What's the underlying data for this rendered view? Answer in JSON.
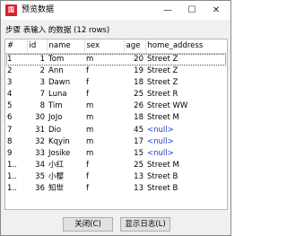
{
  "window": {
    "title": "预览数据",
    "icon_text": "国"
  },
  "subtitle": "步骤 表输入 的数据 (12 rows)",
  "table": {
    "headers": [
      "#",
      "id",
      "name",
      "sex",
      "age",
      "home_address"
    ],
    "rows": [
      {
        "rownum": "1",
        "id": "1",
        "name": "Tom",
        "sex": "m",
        "age": "20",
        "home_address": "Street Z"
      },
      {
        "rownum": "2",
        "id": "2",
        "name": "Ann",
        "sex": "f",
        "age": "19",
        "home_address": "Street Z"
      },
      {
        "rownum": "3",
        "id": "3",
        "name": "Dawn",
        "sex": "f",
        "age": "18",
        "home_address": "Street Z"
      },
      {
        "rownum": "4",
        "id": "7",
        "name": "Luna",
        "sex": "f",
        "age": "25",
        "home_address": "Street R"
      },
      {
        "rownum": "5",
        "id": "8",
        "name": "Tim",
        "sex": "m",
        "age": "26",
        "home_address": "Street WW"
      },
      {
        "rownum": "6",
        "id": "30",
        "name": "JoJo",
        "sex": "m",
        "age": "18",
        "home_address": "Street M"
      },
      {
        "rownum": "7",
        "id": "31",
        "name": "Dio",
        "sex": "m",
        "age": "45",
        "home_address": "<null>"
      },
      {
        "rownum": "8",
        "id": "32",
        "name": "Kqyin",
        "sex": "m",
        "age": "17",
        "home_address": "<null>"
      },
      {
        "rownum": "9",
        "id": "33",
        "name": "Josike",
        "sex": "m",
        "age": "15",
        "home_address": "<null>"
      },
      {
        "rownum": "1..",
        "id": "34",
        "name": "小红",
        "sex": "f",
        "age": "25",
        "home_address": "Street M"
      },
      {
        "rownum": "1..",
        "id": "35",
        "name": "小樱",
        "sex": "f",
        "age": "13",
        "home_address": "Street B"
      },
      {
        "rownum": "1..",
        "id": "36",
        "name": "知世",
        "sex": "f",
        "age": "13",
        "home_address": "Street B"
      }
    ]
  },
  "buttons": {
    "close_label": "关闭(C)",
    "log_label": "显示日志(L)"
  },
  "colors": {
    "null_text": "#1f3fd0",
    "app_icon": "#d8232a"
  }
}
